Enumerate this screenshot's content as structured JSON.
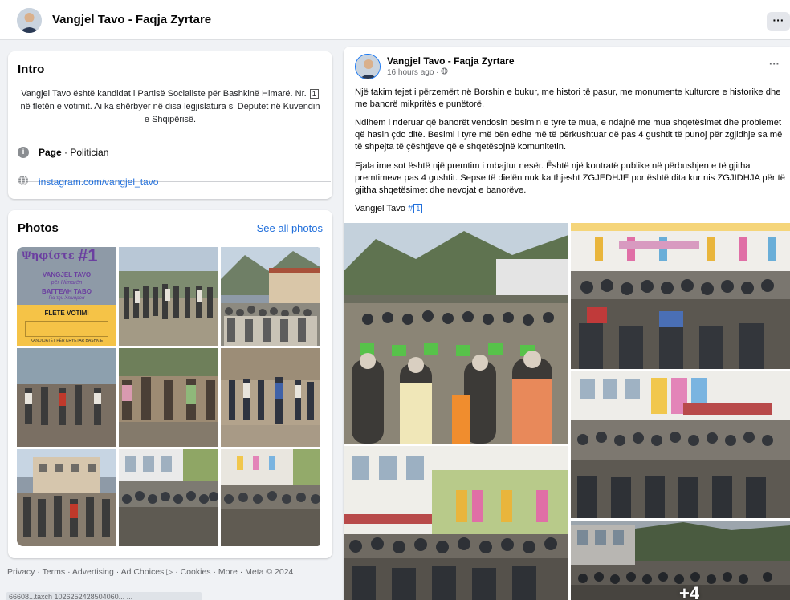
{
  "header": {
    "page_name": "Vangjel Tavo - Faqja Zyrtare",
    "more_label": "···"
  },
  "intro": {
    "title": "Intro",
    "bio_part1": "Vangjel Tavo është kandidat i Partisë Socialiste për Bashkinë Himarë. Nr.",
    "bio_number": "1",
    "bio_part2": "në fletën e votimit. Ai ka shërbyer në disa legjislatura si Deputet në Kuvendin e Shqipërisë.",
    "page_label": "Page",
    "page_category": " · Politician",
    "instagram": "instagram.com/vangjel_tavo"
  },
  "photos": {
    "title": "Photos",
    "see_all": "See all photos",
    "flyer": {
      "line1": "ΨΗΦΙΣΤΕ",
      "vote_word": "Ψηφίστε",
      "number": "#1",
      "name_latin": "VANGJEL TAVO",
      "for_text": "për Himarën",
      "name_greek": "ΒΑΓΓΕΛΗ ΤΑΒΟ",
      "greek_sub": "Για την Χειμάρρα",
      "ballot": "FLETË VOTIMI",
      "candidates": "KANDIDATËT PËR KRYETAR BASHKIE"
    }
  },
  "footer": {
    "text": "Privacy · Terms · Advertising · Ad Choices ▷ · Cookies · More · Meta © 2024"
  },
  "status_url": "66608...taxch 1026252428504060... ...",
  "post": {
    "author": "Vangjel Tavo - Faqja Zyrtare",
    "time": "16 hours ago ·",
    "more": "···",
    "para1": "Një takim tejet i përzemërt në Borshin e bukur, me histori të pasur, me monumente kulturore e historike dhe me banorë mikpritës e punëtorë.",
    "para2": "Ndihem i nderuar që banorët vendosin besimin e tyre te mua, e ndajnë me mua shqetësimet dhe problemet që hasin çdo ditë. Besimi i tyre më bën edhe më të përkushtuar që pas 4 gushtit të punoj për zgjidhje sa më të shpejta të çështjeve që e shqetësojnë komunitetin.",
    "para3": "Fjala ime sot është një premtim i mbajtur nesër. Është një kontratë publike në përbushjen e të gjitha premtimeve pas 4 gushtit. Sepse të dielën nuk ka thjesht ZGJEDHJE por është dita kur nis ZGJIDHJA për të gjitha shqetësimet dhe nevojat e banorëve.",
    "signature": "Vangjel Tavo",
    "hashtag": "#",
    "hashtag_number": "1",
    "more_photos": "+4"
  },
  "colors": {
    "link": "#216fdb",
    "background": "#f0f2f5",
    "flyer_purple": "#6b3fa0",
    "flyer_yellow": "#f5c347"
  }
}
